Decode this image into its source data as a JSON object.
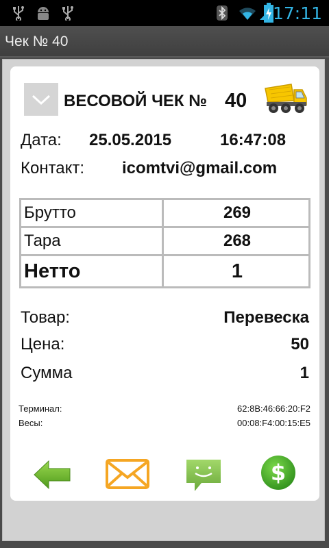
{
  "statusbar": {
    "time": "17:11",
    "icons": [
      "usb-icon",
      "android-debug-icon",
      "usb-icon",
      "bluetooth-icon",
      "wifi-icon",
      "signal-icon",
      "battery-charging-icon"
    ]
  },
  "titlebar": {
    "title": "Чек № 40"
  },
  "receipt": {
    "heading": "ВЕСОВОЙ ЧЕК №",
    "number": "40",
    "date_label": "Дата:",
    "date": "25.05.2015",
    "time": "16:47:08",
    "contact_label": "Контакт:",
    "contact": "icomtvi@gmail.com",
    "weights": [
      {
        "label": "Брутто",
        "value": "269"
      },
      {
        "label": "Тара",
        "value": "268"
      },
      {
        "label": "Нетто",
        "value": "1"
      }
    ],
    "goods_label": "Товар:",
    "goods": "Перевеска",
    "price_label": "Цена:",
    "price": "50",
    "sum_label": "Сумма",
    "sum": "1",
    "terminal_label": "Терминал:",
    "terminal": "62:8B:46:66:20:F2",
    "scales_label": "Весы:",
    "scales": "00:08:F4:00:15:E5"
  },
  "actions": [
    "back-arrow-icon",
    "email-icon",
    "sms-icon",
    "dollar-icon"
  ],
  "colors": {
    "accent_blue": "#33b5e5",
    "green": "#6ab82e",
    "orange": "#f5a623",
    "truck_yellow": "#f7c600"
  }
}
